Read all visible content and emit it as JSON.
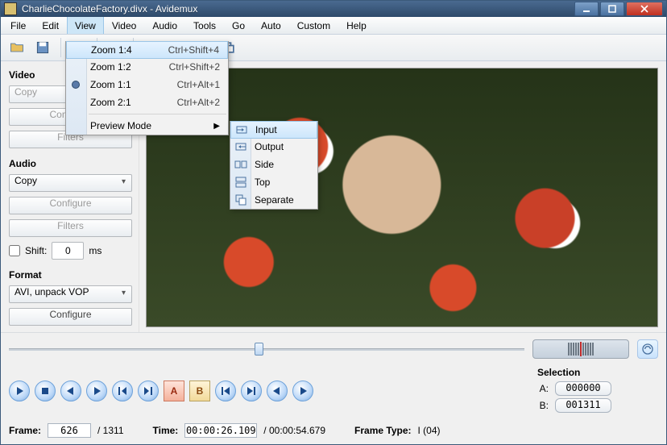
{
  "title": "CharlieChocolateFactory.divx - Avidemux",
  "menubar": [
    "File",
    "Edit",
    "View",
    "Video",
    "Audio",
    "Tools",
    "Go",
    "Auto",
    "Custom",
    "Help"
  ],
  "view_menu": {
    "items": [
      {
        "label": "Zoom 1:4",
        "shortcut": "Ctrl+Shift+4",
        "highlight": true
      },
      {
        "label": "Zoom 1:2",
        "shortcut": "Ctrl+Shift+2"
      },
      {
        "label": "Zoom 1:1",
        "shortcut": "Ctrl+Alt+1",
        "indicator": true
      },
      {
        "label": "Zoom 2:1",
        "shortcut": "Ctrl+Alt+2"
      }
    ],
    "preview_label": "Preview Mode"
  },
  "preview_submenu": [
    "Input",
    "Output",
    "Side",
    "Top",
    "Separate"
  ],
  "sidebar": {
    "video_label": "Video",
    "video_select": "Copy",
    "configure": "Configure",
    "filters": "Filters",
    "audio_label": "Audio",
    "audio_select": "Copy",
    "shift_label": "Shift:",
    "shift_val": "0",
    "shift_unit": "ms",
    "format_label": "Format",
    "format_select": "AVI, unpack VOP"
  },
  "selection": {
    "title": "Selection",
    "a_label": "A:",
    "b_label": "B:",
    "a": "000000",
    "b": "001311"
  },
  "status": {
    "frame_label": "Frame:",
    "frame": "626",
    "frame_total": "/ 1311",
    "time_label": "Time:",
    "time": "00:00:26.109",
    "time_total": "/ 00:00:54.679",
    "type_label": "Frame Type:",
    "type": "I (04)"
  }
}
